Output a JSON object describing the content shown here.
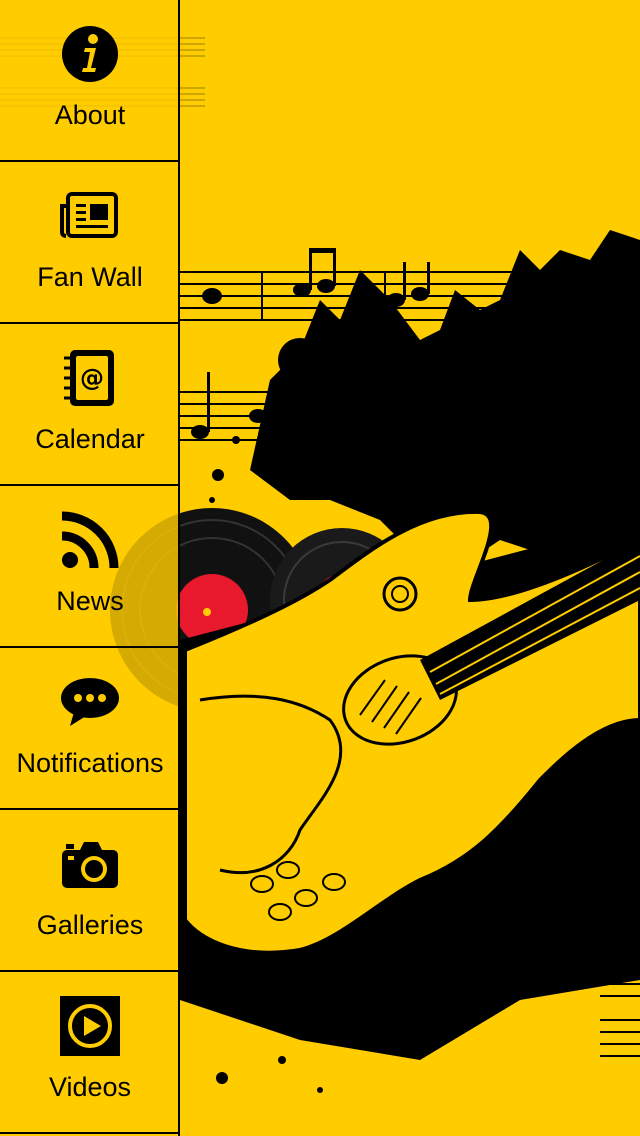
{
  "theme": {
    "background": "#FFCC00",
    "ink": "#000000",
    "record_label": "#E8192C"
  },
  "sidebar": {
    "items": [
      {
        "label": "About",
        "icon": "info-icon"
      },
      {
        "label": "Fan Wall",
        "icon": "newspaper-icon"
      },
      {
        "label": "Calendar",
        "icon": "address-book-icon"
      },
      {
        "label": "News",
        "icon": "rss-icon"
      },
      {
        "label": "Notifications",
        "icon": "chat-bubble-icon"
      },
      {
        "label": "Galleries",
        "icon": "camera-icon"
      },
      {
        "label": "Videos",
        "icon": "play-icon"
      }
    ]
  }
}
